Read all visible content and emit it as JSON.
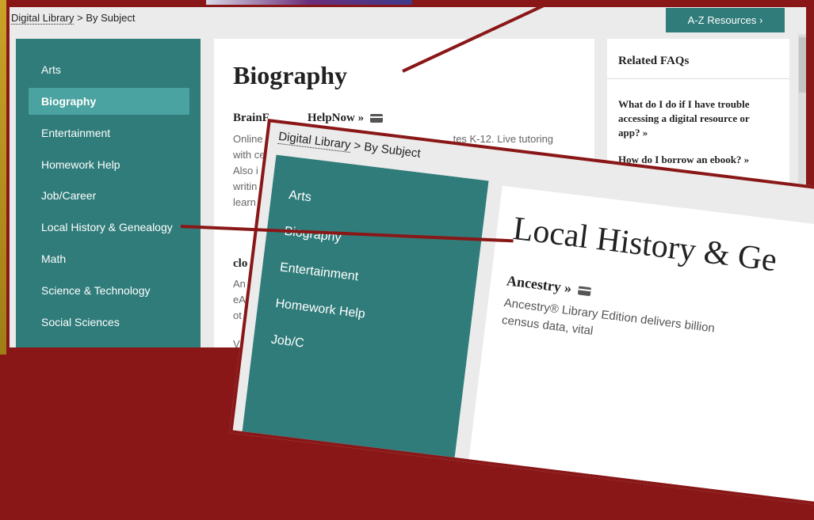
{
  "breadcrumb": {
    "link": "Digital Library",
    "sep": ">",
    "current": "By Subject"
  },
  "az_button": "A-Z Resources  ›",
  "sidebar": {
    "items": [
      {
        "label": "Arts"
      },
      {
        "label": "Biography",
        "active": true
      },
      {
        "label": "Entertainment"
      },
      {
        "label": "Homework Help"
      },
      {
        "label": "Job/Career"
      },
      {
        "label": "Local History & Genealogy"
      },
      {
        "label": "Math"
      },
      {
        "label": "Science & Technology"
      },
      {
        "label": "Social Sciences"
      }
    ]
  },
  "main": {
    "heading": "Biography",
    "resource1": {
      "title_start": "BrainF",
      "title_end": "HelpNow »"
    },
    "desc_lines": [
      "Online",
      "with ce",
      "Also i",
      "writin",
      "learn"
    ],
    "desc_right": "tes K-12. Live tutoring",
    "resource2": {
      "title": "clo"
    },
    "desc2_lines": [
      "An",
      "eA",
      "ot",
      "V"
    ]
  },
  "faq": {
    "heading": "Related FAQs",
    "items": [
      "What do I do if I have trouble accessing a digital resource or app? »",
      "How do I borrow an ebook? »"
    ]
  },
  "overlay": {
    "breadcrumb": {
      "link": "Digital Library",
      "sep": ">",
      "current": "By Subject"
    },
    "sidebar_items": [
      "Arts",
      "Biography",
      "Entertainment",
      "Homework Help",
      "Job/C"
    ],
    "heading": "Local History & Ge",
    "resource": "Ancestry »",
    "desc": "Ancestry® Library Edition delivers billion",
    "desc2": "census data, vital"
  },
  "colors": {
    "teal": "#2f7c7a",
    "active": "#4aa3a0",
    "frame": "#8a1717",
    "gold": "#c9a227"
  },
  "icons": [
    "card-icon"
  ]
}
